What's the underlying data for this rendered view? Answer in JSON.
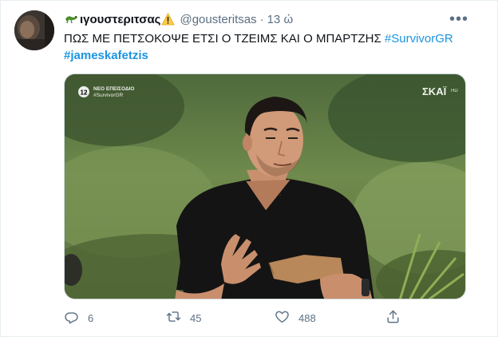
{
  "tweet": {
    "display_name": "ιγουστεριτσας",
    "handle": "@gousteritsas",
    "separator": "·",
    "time": "13 ώ",
    "text_line1": "ΠΩΣ ΜΕ ΠΕΤΣΟΚΟΨΕ ΕΤΣΙ Ο ΤΖΕΙΜΣ ΚΑΙ Ο ΜΠΑΡΤΖΗΣ",
    "hashtag1": "#SurvivorGR",
    "hashtag2": "#jameskafetzis",
    "more_label": "•••"
  },
  "media": {
    "channel_badge_number": "12",
    "badge_line1": "ΝΕΟ ΕΠΕΙΣΟΔΙΟ",
    "badge_line2": "#SurvivorGR",
    "network_logo": "ΣΚΑΪ",
    "network_logo_suffix": "HD"
  },
  "actions": {
    "replies": "6",
    "retweets": "45",
    "likes": "488"
  },
  "colors": {
    "hashtag": "#1b95e0",
    "secondary_text": "#5b7083",
    "border": "#e6ecf0"
  },
  "icons": {
    "reply": "reply-icon",
    "retweet": "retweet-icon",
    "like": "heart-icon",
    "share": "share-icon",
    "more": "more-icon",
    "name_emoji": "lizard-icon",
    "warning": "warning-icon"
  }
}
